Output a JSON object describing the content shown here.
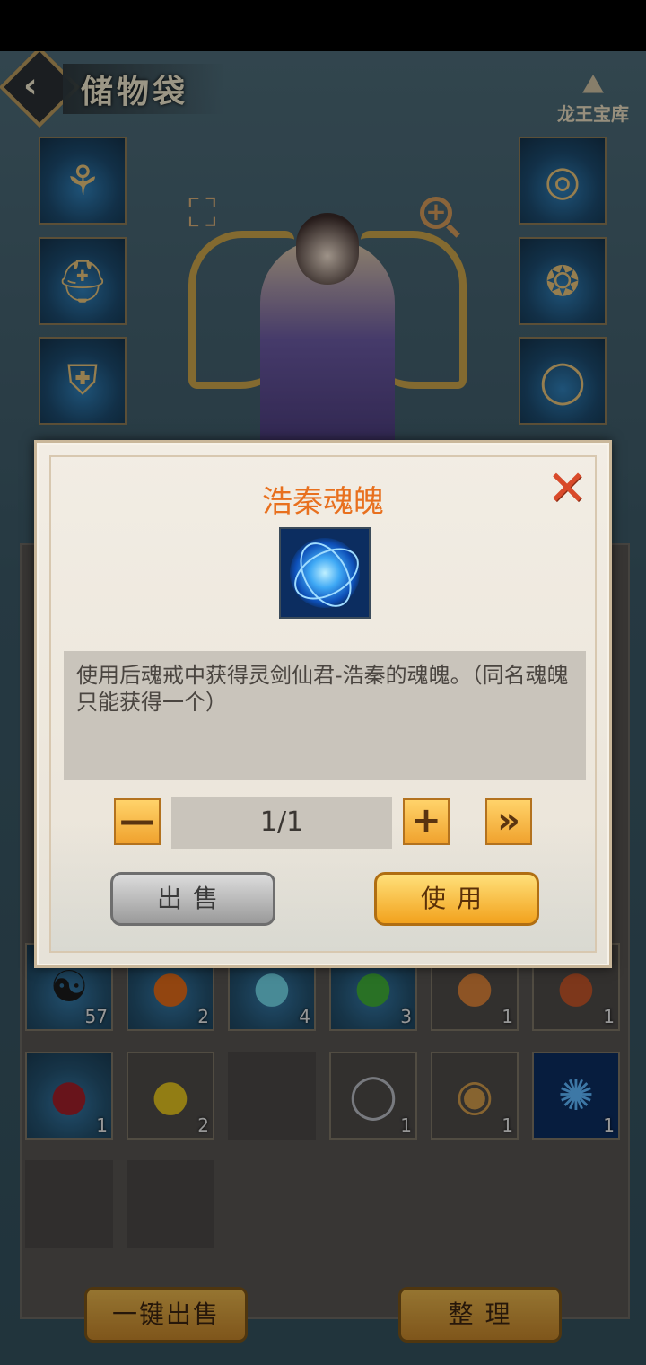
{
  "header": {
    "title": "储物袋",
    "logo_text": "龙王宝库"
  },
  "equipment": {
    "left": [
      {
        "icon": "fan-icon",
        "glyph": "⚘"
      },
      {
        "icon": "helmet-icon",
        "glyph": "⛑"
      },
      {
        "icon": "armor-icon",
        "glyph": "⛨"
      }
    ],
    "right": [
      {
        "icon": "ring-icon",
        "glyph": "◎"
      },
      {
        "icon": "pendant-icon",
        "glyph": "❂"
      },
      {
        "icon": "bracelet-icon",
        "glyph": "◯"
      }
    ]
  },
  "bag": {
    "row1": [
      {
        "icon": "yin-yang-gourd-icon",
        "glyph": "☯",
        "count": "57"
      },
      {
        "icon": "orange-fruit-icon",
        "glyph": "●",
        "count": "2"
      },
      {
        "icon": "blue-berries-icon",
        "glyph": "●",
        "count": "4"
      },
      {
        "icon": "green-fruit-icon",
        "glyph": "●",
        "count": "3"
      },
      {
        "icon": "sweet-potato-icon",
        "glyph": "●",
        "count": "1"
      },
      {
        "icon": "peach-icon",
        "glyph": "●",
        "count": "1"
      }
    ],
    "row2": [
      {
        "icon": "red-fruit-icon",
        "glyph": "●",
        "count": "1"
      },
      {
        "icon": "yellow-fruit-icon",
        "glyph": "●",
        "count": "2"
      },
      {
        "icon": "empty-slot",
        "glyph": "",
        "count": ""
      },
      {
        "icon": "silver-ring-icon",
        "glyph": "◯",
        "count": "1"
      },
      {
        "icon": "gem-ring-icon",
        "glyph": "◉",
        "count": "1"
      },
      {
        "icon": "soul-orb-icon",
        "glyph": "✺",
        "count": "1"
      }
    ],
    "bottom_buttons": {
      "sell_all": "一键出售",
      "organize": "整 理"
    }
  },
  "modal": {
    "title": "浩秦魂魄",
    "description": "使用后魂戒中获得灵剑仙君-浩秦的魂魄。（同名魂魄只能获得一个）",
    "quantity": "1/1",
    "minus": "—",
    "plus": "+",
    "max": "»",
    "sell": "出售",
    "use": "使用",
    "close": "✕"
  },
  "colors": {
    "title_orange": "#e8701e",
    "button_gold": "#f2a21d",
    "close_red": "#d94a2a"
  }
}
